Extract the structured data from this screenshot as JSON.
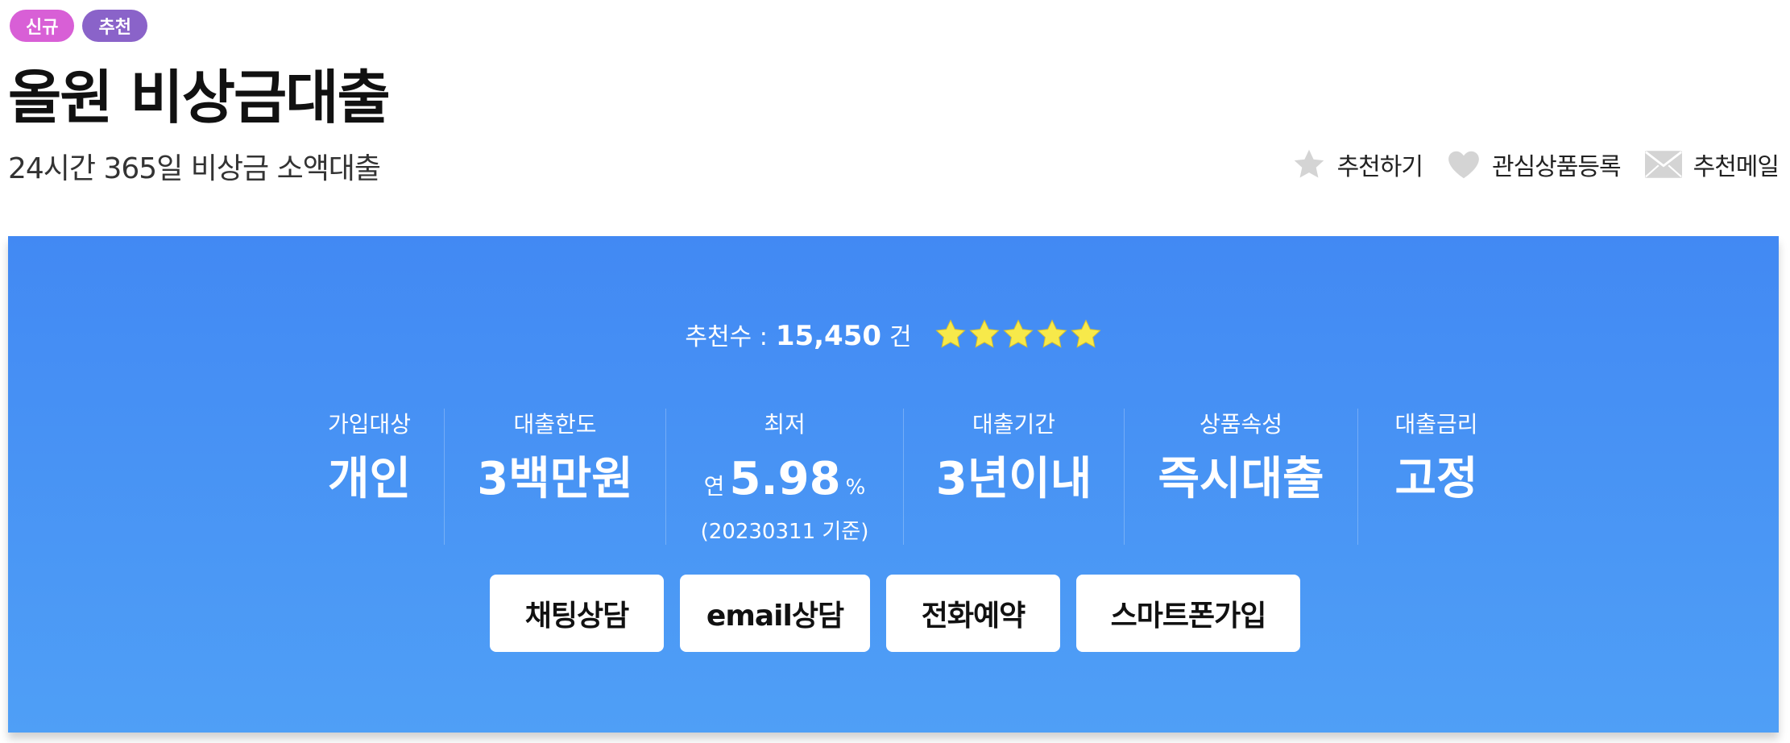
{
  "badges": {
    "new": "신규",
    "recommended": "추천"
  },
  "product": {
    "title": "올원 비상금대출",
    "subtitle": "24시간 365일 비상금 소액대출"
  },
  "actions": {
    "recommend": "추천하기",
    "wishlist": "관심상품등록",
    "mail": "추천메일"
  },
  "recommendation": {
    "label": "추천수 :",
    "count": "15,450",
    "unit": "건",
    "rating": 5
  },
  "specs": {
    "target": {
      "label": "가입대상",
      "value": "개인"
    },
    "limit": {
      "label": "대출한도",
      "value": "3백만원"
    },
    "rate": {
      "label": "최저",
      "prefix": "연",
      "value": "5.98",
      "unit": "%",
      "note": "(20230311 기준)"
    },
    "period": {
      "label": "대출기간",
      "value": "3년이내"
    },
    "attribute": {
      "label": "상품속성",
      "value": "즉시대출"
    },
    "interest": {
      "label": "대출금리",
      "value": "고정"
    }
  },
  "buttons": {
    "chat": "채팅상담",
    "email": "email상담",
    "phone": "전화예약",
    "smartphone": "스마트폰가입"
  },
  "colors": {
    "badge_new": "#d85fd6",
    "badge_recommended": "#8a63c9",
    "panel": "#4a94f5",
    "star": "#f7e94a",
    "action_icon": "#d4d4d4"
  },
  "icons": {
    "recommend": "star-icon",
    "wishlist": "heart-icon",
    "mail": "envelope-icon"
  }
}
